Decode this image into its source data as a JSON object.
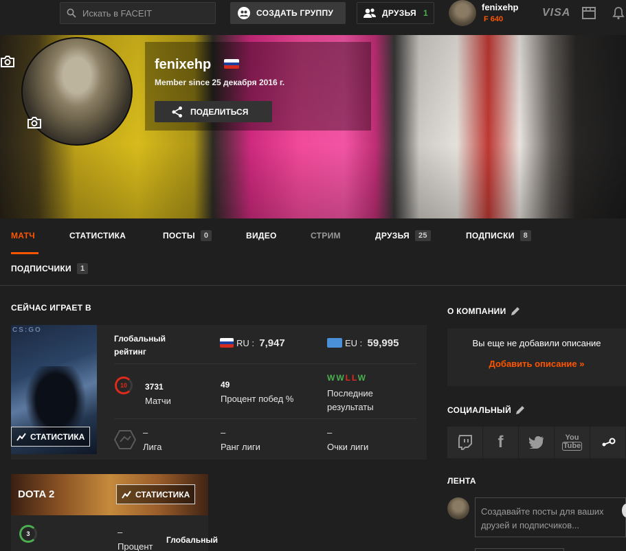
{
  "topbar": {
    "search_placeholder": "Искать в FACEIT",
    "create_group": "СОЗДАТЬ ГРУППУ",
    "friends": "ДРУЗЬЯ",
    "friends_count": "1",
    "username": "fenixehp",
    "points": "640",
    "visa": "VISA"
  },
  "profile": {
    "name": "fenixehp",
    "member_since": "Member since 25 декабря 2016 г.",
    "share": "ПОДЕЛИТЬСЯ"
  },
  "tabs": [
    {
      "label": "МАТЧ"
    },
    {
      "label": "СТАТИСТИКА"
    },
    {
      "label": "ПОСТЫ",
      "count": "0"
    },
    {
      "label": "ВИДЕО"
    },
    {
      "label": "СТРИМ"
    },
    {
      "label": "ДРУЗЬЯ",
      "count": "25"
    },
    {
      "label": "ПОДПИСКИ",
      "count": "8"
    },
    {
      "label": "ПОДПИСЧИКИ",
      "count": "1"
    }
  ],
  "now_playing": {
    "heading": "СЕЙЧАС ИГРАЕТ В",
    "csgo": {
      "stats_button": "СТАТИСТИКА",
      "global_rating": "Глобальный рейтинг",
      "ru_label": "RU :",
      "ru_value": "7,947",
      "eu_label": "EU :",
      "eu_value": "59,995",
      "level": "10",
      "matches_value": "3731",
      "matches_label": "Матчи",
      "winrate_value": "49",
      "winrate_label": "Процент побед %",
      "recent_results": [
        "W",
        "W",
        "L",
        "L",
        "W"
      ],
      "recent_label": "Последние результаты",
      "league_value": "–",
      "league_label": "Лига",
      "league_rank_value": "–",
      "league_rank_label": "Ранг лиги",
      "league_points_value": "–",
      "league_points_label": "Очки лиги"
    },
    "dota": {
      "title": "DOTA 2",
      "stats_button": "СТАТИСТИКА",
      "level": "3",
      "winrate_value": "–",
      "winrate_label": "Процент",
      "global_label": "Глобальный"
    }
  },
  "about": {
    "heading": "О КОМПАНИИ",
    "empty": "Вы еще не добавили описание",
    "add": "Добавить описание »"
  },
  "social": {
    "heading": "СОЦИАЛЬНЫЙ",
    "items": [
      "twitch-icon",
      "facebook-icon",
      "twitter-icon",
      "youtube-icon",
      "steam-icon"
    ]
  },
  "feed": {
    "heading": "ЛЕНТА",
    "placeholder": "Создавайте посты для ваших друзей и подписчиков..."
  },
  "colors": {
    "accent": "#ff5500",
    "win": "#4caf50",
    "loss": "#e02a1b"
  }
}
